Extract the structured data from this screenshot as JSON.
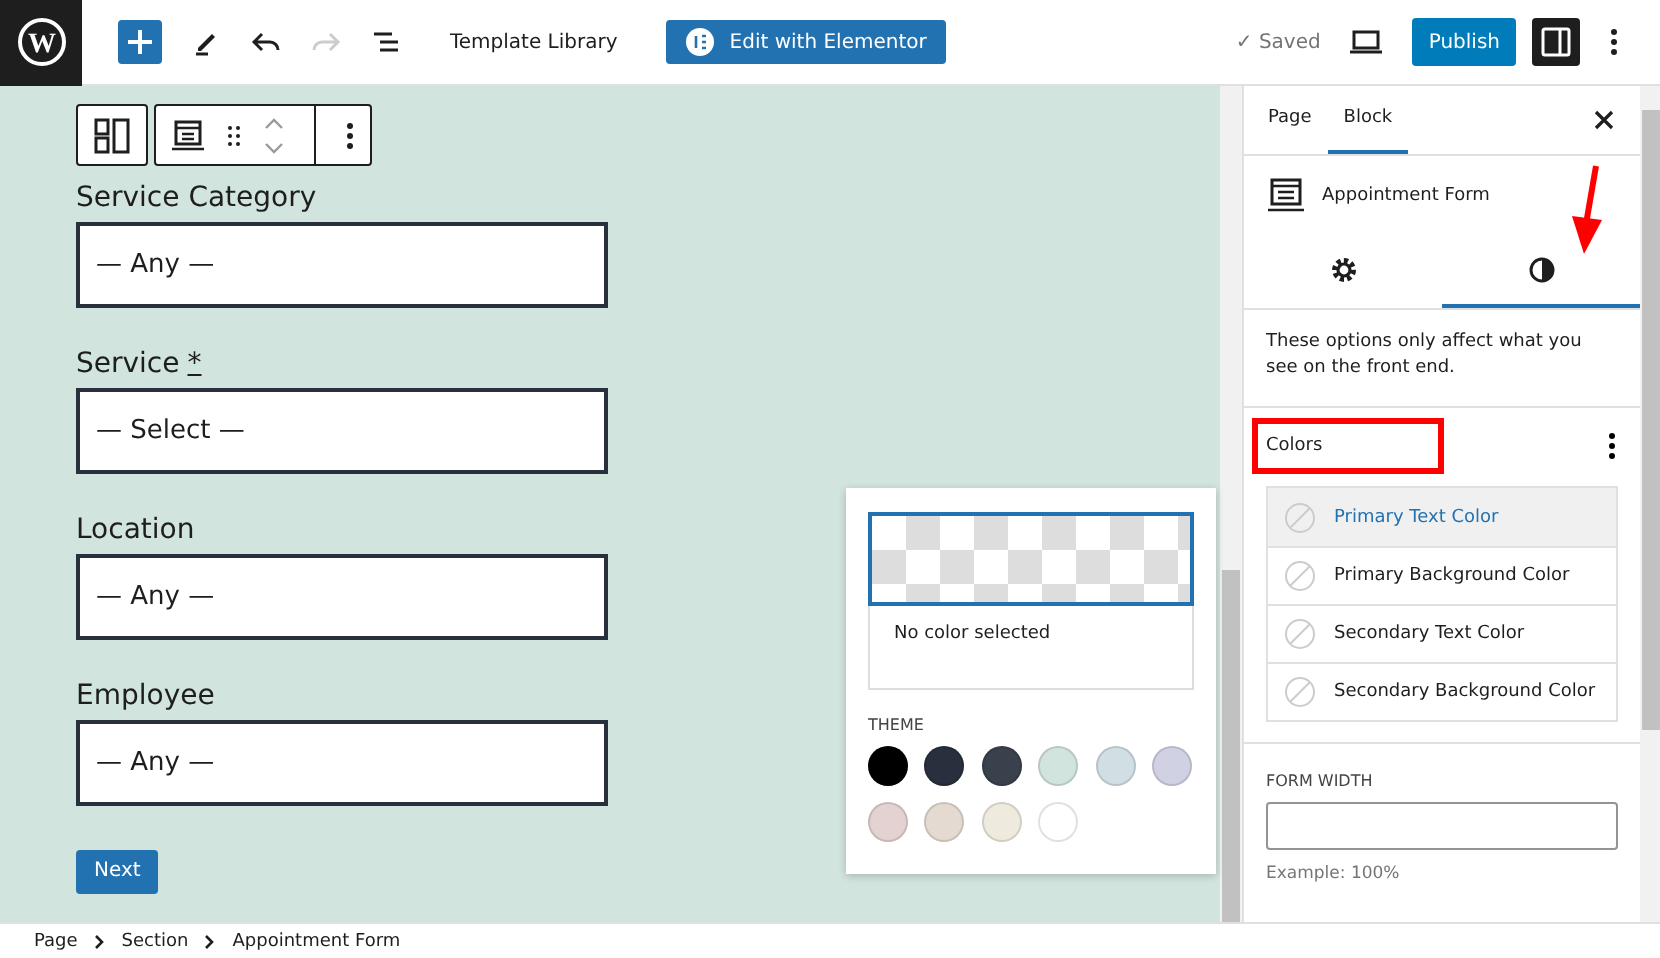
{
  "topbar": {
    "logo_letter": "W",
    "saved_icon": "✓",
    "document_title": "Template Library",
    "elementor_button": "Edit with Elementor",
    "saved_label": "Saved",
    "publish_button": "Publish",
    "settings_toggle_on": true
  },
  "form": {
    "fields": [
      {
        "label": "Service Category",
        "value": "— Any —"
      },
      {
        "label": "Service",
        "required_mark": "*",
        "value": "— Select —"
      },
      {
        "label": "Location",
        "value": "— Any —"
      },
      {
        "label": "Employee",
        "value": "— Any —"
      }
    ],
    "next_button": "Next"
  },
  "color_popover": {
    "preview_label": "No color selected",
    "theme_heading": "THEME",
    "swatches": [
      {
        "color": "#000000"
      },
      {
        "color": "#28303d"
      },
      {
        "color": "#39414d"
      },
      {
        "color": "#d1e4dd"
      },
      {
        "color": "#d1dfe4"
      },
      {
        "color": "#d1d1e4"
      },
      {
        "color": "#e4d1d1"
      },
      {
        "color": "#e4dad1"
      },
      {
        "color": "#eeeadd"
      },
      {
        "color": "#ffffff"
      }
    ]
  },
  "sidebar": {
    "tabs": [
      {
        "label": "Page",
        "selected": false
      },
      {
        "label": "Block",
        "selected": true
      }
    ],
    "block_name": "Appointment Form",
    "icon_tabs": [
      {
        "kind": "settings",
        "selected": false,
        "annotated": false
      },
      {
        "kind": "styles",
        "selected": true,
        "annotated": true
      }
    ],
    "description": "These options only affect what you see on the front end.",
    "colors": {
      "title": "Colors",
      "highlighted": true,
      "items": [
        {
          "label": "Primary Text Color",
          "selected": true
        },
        {
          "label": "Primary Background Color",
          "selected": false
        },
        {
          "label": "Secondary Text Color",
          "selected": false
        },
        {
          "label": "Secondary Background Color",
          "selected": false
        }
      ]
    },
    "form_width": {
      "label": "FORM WIDTH",
      "help": "Example: 100%"
    }
  },
  "breadcrumb": [
    "Page",
    "Section",
    "Appointment Form"
  ]
}
